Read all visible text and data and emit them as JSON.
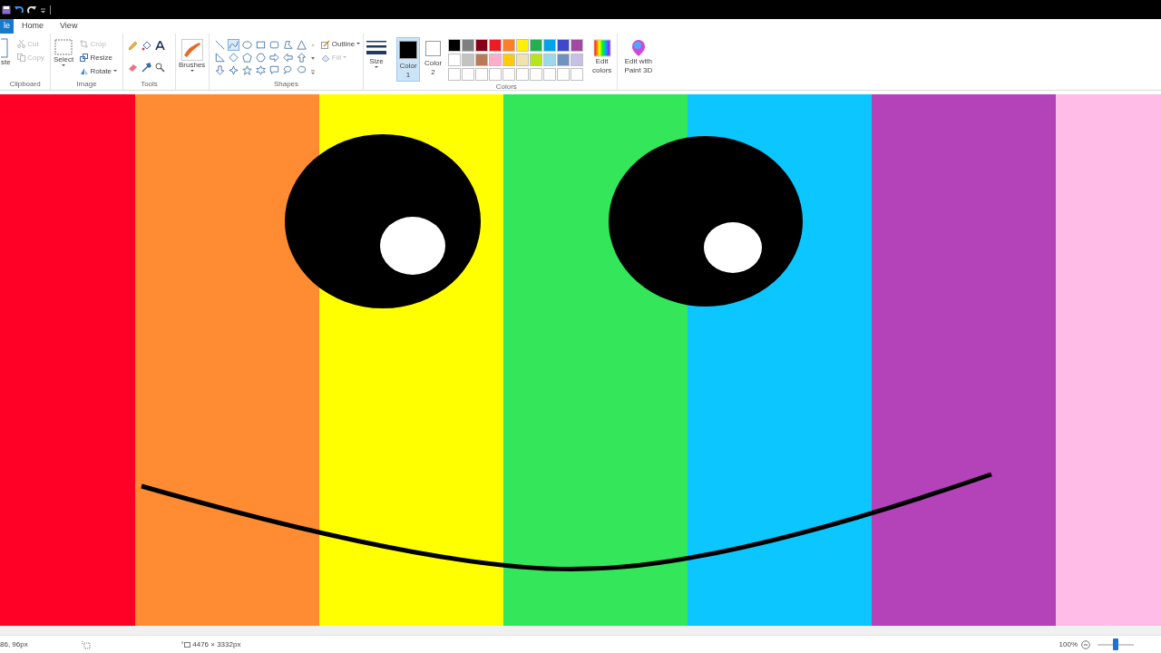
{
  "tabs": [
    {
      "label": "le",
      "selected": true
    },
    {
      "label": "Home",
      "selected": false
    },
    {
      "label": "View",
      "selected": false
    }
  ],
  "clipboard": {
    "paste": "ste",
    "cut": "Cut",
    "copy": "Copy",
    "cut_disabled": true,
    "copy_disabled": true,
    "label": "Clipboard"
  },
  "image": {
    "select": "Select",
    "crop": "Crop",
    "resize": "Resize",
    "rotate": "Rotate",
    "crop_disabled": true,
    "label": "Image"
  },
  "tools": {
    "label": "Tools"
  },
  "brushes": {
    "label": "Brushes"
  },
  "shapes": {
    "label": "Shapes",
    "outline": "Outline",
    "fill": "Fill",
    "fill_disabled": true,
    "items": [
      {
        "selected": false
      },
      {
        "selected": true
      },
      {
        "selected": false
      },
      {
        "selected": false
      },
      {
        "selected": false
      },
      {
        "selected": false
      },
      {
        "selected": false
      },
      {
        "selected": false
      },
      {
        "selected": false
      },
      {
        "selected": false
      },
      {
        "selected": false
      },
      {
        "selected": false
      },
      {
        "selected": false
      },
      {
        "selected": false
      },
      {
        "selected": false
      },
      {
        "selected": false
      },
      {
        "selected": false
      },
      {
        "selected": false
      },
      {
        "selected": false
      },
      {
        "selected": false
      },
      {
        "selected": false
      }
    ]
  },
  "size": {
    "label": "Size"
  },
  "color_slots": [
    {
      "label": "Color",
      "number": "1",
      "color": "#000000",
      "selected": true
    },
    {
      "label": "Color",
      "number": "2",
      "color": "#ffffff",
      "selected": false
    }
  ],
  "palette": [
    {
      "color": "#000000"
    },
    {
      "color": "#7f7f7f"
    },
    {
      "color": "#880015"
    },
    {
      "color": "#ed1c24"
    },
    {
      "color": "#ff7f27"
    },
    {
      "color": "#fff200"
    },
    {
      "color": "#22b14c"
    },
    {
      "color": "#00a2e8"
    },
    {
      "color": "#3f48cc"
    },
    {
      "color": "#a349a4"
    },
    {
      "color": "#ffffff"
    },
    {
      "color": "#c3c3c3"
    },
    {
      "color": "#b97a57"
    },
    {
      "color": "#ffaec9"
    },
    {
      "color": "#ffc90e"
    },
    {
      "color": "#efe4b0"
    },
    {
      "color": "#b5e61d"
    },
    {
      "color": "#99d9ea"
    },
    {
      "color": "#7092be"
    },
    {
      "color": "#c8bfe7"
    }
  ],
  "colors_label": "Colors",
  "edit_colors": "Edit colors",
  "paint3d": "Edit with Paint 3D",
  "canvas": {
    "stripes": [
      {
        "color": "#ff0027"
      },
      {
        "color": "#ff8c32"
      },
      {
        "color": "#ffff00"
      },
      {
        "color": "#33e65a"
      },
      {
        "color": "#0bc6ff"
      },
      {
        "color": "#b443b9"
      },
      {
        "color": "#ffbce6"
      }
    ]
  },
  "status_bar": {
    "position": "86, 96px",
    "image_size": "4476 × 3332px",
    "zoom": "100%",
    "zoom_slider": {
      "level": 0.5
    }
  }
}
